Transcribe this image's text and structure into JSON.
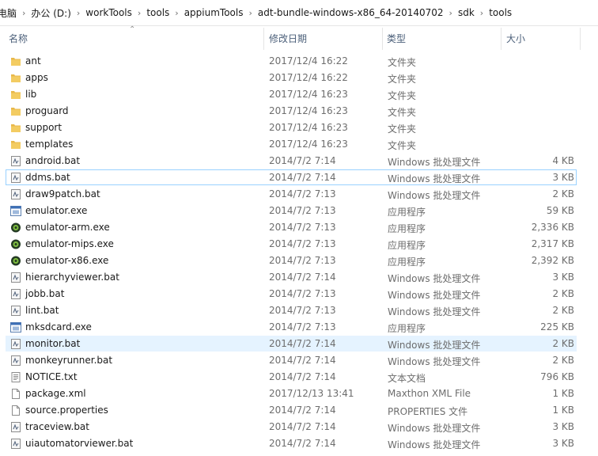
{
  "breadcrumb": [
    "电脑",
    "办公 (D:)",
    "workTools",
    "tools",
    "appiumTools",
    "adt-bundle-windows-x86_64-20140702",
    "sdk",
    "tools"
  ],
  "columns": {
    "name": "名称",
    "date": "修改日期",
    "type": "类型",
    "size": "大小"
  },
  "colors": {
    "folder": "#e8b84a",
    "accent_selection": "#e5f3ff",
    "focus_border": "#99d1ff",
    "header_text": "#4c607a"
  },
  "files": [
    {
      "name": "ant",
      "date": "2017/12/4 16:22",
      "type": "文件夹",
      "size": "",
      "icon": "folder-icon"
    },
    {
      "name": "apps",
      "date": "2017/12/4 16:22",
      "type": "文件夹",
      "size": "",
      "icon": "folder-icon"
    },
    {
      "name": "lib",
      "date": "2017/12/4 16:23",
      "type": "文件夹",
      "size": "",
      "icon": "folder-icon"
    },
    {
      "name": "proguard",
      "date": "2017/12/4 16:23",
      "type": "文件夹",
      "size": "",
      "icon": "folder-icon"
    },
    {
      "name": "support",
      "date": "2017/12/4 16:23",
      "type": "文件夹",
      "size": "",
      "icon": "folder-icon"
    },
    {
      "name": "templates",
      "date": "2017/12/4 16:23",
      "type": "文件夹",
      "size": "",
      "icon": "folder-icon"
    },
    {
      "name": "android.bat",
      "date": "2014/7/2 7:14",
      "type": "Windows 批处理文件",
      "size": "4 KB",
      "icon": "bat-file-icon"
    },
    {
      "name": "ddms.bat",
      "date": "2014/7/2 7:14",
      "type": "Windows 批处理文件",
      "size": "3 KB",
      "icon": "bat-file-icon",
      "state": "focused"
    },
    {
      "name": "draw9patch.bat",
      "date": "2014/7/2 7:13",
      "type": "Windows 批处理文件",
      "size": "2 KB",
      "icon": "bat-file-icon"
    },
    {
      "name": "emulator.exe",
      "date": "2014/7/2 7:13",
      "type": "应用程序",
      "size": "59 KB",
      "icon": "exe-icon"
    },
    {
      "name": "emulator-arm.exe",
      "date": "2014/7/2 7:13",
      "type": "应用程序",
      "size": "2,336 KB",
      "icon": "android-exe-icon"
    },
    {
      "name": "emulator-mips.exe",
      "date": "2014/7/2 7:13",
      "type": "应用程序",
      "size": "2,317 KB",
      "icon": "android-exe-icon"
    },
    {
      "name": "emulator-x86.exe",
      "date": "2014/7/2 7:13",
      "type": "应用程序",
      "size": "2,392 KB",
      "icon": "android-exe-icon"
    },
    {
      "name": "hierarchyviewer.bat",
      "date": "2014/7/2 7:14",
      "type": "Windows 批处理文件",
      "size": "3 KB",
      "icon": "bat-file-icon"
    },
    {
      "name": "jobb.bat",
      "date": "2014/7/2 7:13",
      "type": "Windows 批处理文件",
      "size": "2 KB",
      "icon": "bat-file-icon"
    },
    {
      "name": "lint.bat",
      "date": "2014/7/2 7:13",
      "type": "Windows 批处理文件",
      "size": "2 KB",
      "icon": "bat-file-icon"
    },
    {
      "name": "mksdcard.exe",
      "date": "2014/7/2 7:13",
      "type": "应用程序",
      "size": "225 KB",
      "icon": "exe-icon"
    },
    {
      "name": "monitor.bat",
      "date": "2014/7/2 7:14",
      "type": "Windows 批处理文件",
      "size": "2 KB",
      "icon": "bat-file-icon",
      "state": "hovered"
    },
    {
      "name": "monkeyrunner.bat",
      "date": "2014/7/2 7:14",
      "type": "Windows 批处理文件",
      "size": "2 KB",
      "icon": "bat-file-icon"
    },
    {
      "name": "NOTICE.txt",
      "date": "2014/7/2 7:14",
      "type": "文本文档",
      "size": "796 KB",
      "icon": "text-file-icon"
    },
    {
      "name": "package.xml",
      "date": "2017/12/13 13:41",
      "type": "Maxthon XML File",
      "size": "1 KB",
      "icon": "blank-file-icon"
    },
    {
      "name": "source.properties",
      "date": "2014/7/2 7:14",
      "type": "PROPERTIES 文件",
      "size": "1 KB",
      "icon": "blank-file-icon"
    },
    {
      "name": "traceview.bat",
      "date": "2014/7/2 7:14",
      "type": "Windows 批处理文件",
      "size": "3 KB",
      "icon": "bat-file-icon"
    },
    {
      "name": "uiautomatorviewer.bat",
      "date": "2014/7/2 7:14",
      "type": "Windows 批处理文件",
      "size": "3 KB",
      "icon": "bat-file-icon"
    }
  ]
}
